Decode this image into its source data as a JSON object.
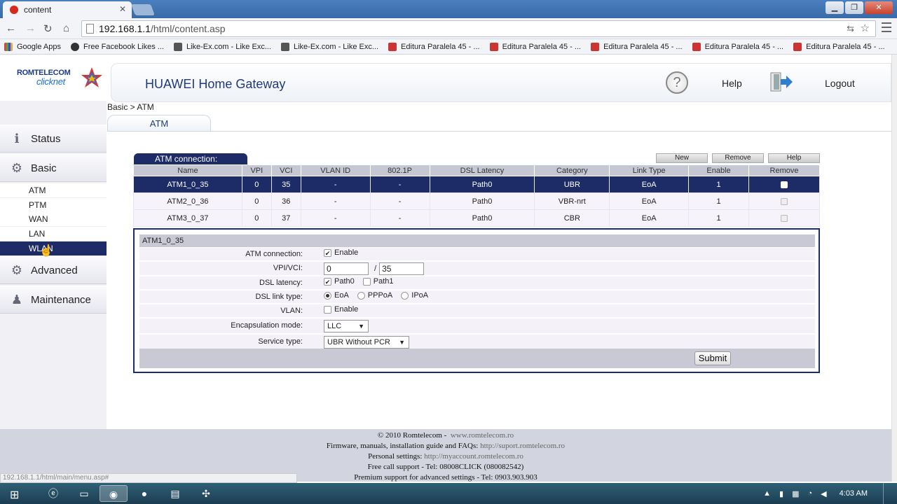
{
  "browser": {
    "tab_title": "content",
    "url_host": "192.168.1.1",
    "url_path": "/html/content.asp",
    "bookmarks": [
      "Google Apps",
      "Free Facebook Likes ...",
      "Like-Ex.com - Like Exc...",
      "Like-Ex.com - Like Exc...",
      "Editura Paralela 45 - ...",
      "Editura Paralela 45 - ...",
      "Editura Paralela 45 - ...",
      "Editura Paralela 45 - ...",
      "Editura Paralela 45 - ..."
    ],
    "status_url": "192.168.1.1/html/main/menu.asp#"
  },
  "logo": {
    "line1": "ROMTELECOM",
    "line2": "clicknet"
  },
  "header": {
    "title": "HUAWEI Home Gateway",
    "help": "Help",
    "logout": "Logout"
  },
  "sidebar": {
    "groups": [
      "Status",
      "Basic",
      "Advanced",
      "Maintenance"
    ],
    "subitems": [
      "ATM",
      "PTM",
      "WAN",
      "LAN",
      "WLAN"
    ]
  },
  "breadcrumb": "Basic > ATM",
  "tab_label": "ATM",
  "atm": {
    "caption": "ATM connection:",
    "buttons": [
      "New",
      "Remove",
      "Help"
    ],
    "columns": [
      "Name",
      "VPI",
      "VCI",
      "VLAN ID",
      "802.1P",
      "DSL Latency",
      "Category",
      "Link Type",
      "Enable",
      "Remove"
    ],
    "rows": [
      [
        "ATM1_0_35",
        "0",
        "35",
        "-",
        "-",
        "Path0",
        "UBR",
        "EoA",
        "1"
      ],
      [
        "ATM2_0_36",
        "0",
        "36",
        "-",
        "-",
        "Path0",
        "VBR-nrt",
        "EoA",
        "1"
      ],
      [
        "ATM3_0_37",
        "0",
        "37",
        "-",
        "-",
        "Path0",
        "CBR",
        "EoA",
        "1"
      ]
    ]
  },
  "detail": {
    "title": "ATM1_0_35",
    "labels": {
      "atm_connection": "ATM connection:",
      "vpi_vci": "VPI/VCI:",
      "dsl_latency": "DSL latency:",
      "dsl_link_type": "DSL link type:",
      "vlan": "VLAN:",
      "encapsulation": "Encapsulation mode:",
      "service_type": "Service type:"
    },
    "enable": "Enable",
    "vpi": "0",
    "slash": "/",
    "vci": "35",
    "path0": "Path0",
    "path1": "Path1",
    "link_types": [
      "EoA",
      "PPPoA",
      "IPoA"
    ],
    "vlan_enable": "Enable",
    "encapsulation": "LLC",
    "service_type": "UBR Without PCR",
    "submit": "Submit"
  },
  "footer": {
    "line1_text": "© 2010 Romtelecom -",
    "line1_link": "www.romtelecom.ro",
    "line2_text": "Firmware, manuals, installation guide and FAQs:",
    "line2_link": "http://suport.romtelecom.ro",
    "line3_text": "Personal settings:",
    "line3_link": "http://myaccount.romtelecom.ro",
    "line4": "Free call support - Tel: 08008CLICK (080082542)",
    "line5": "Premium support for advanced settings - Tel: 0903.903.903"
  },
  "taskbar": {
    "time": "4:03 AM"
  },
  "colors": {
    "accent": "#1d2b66",
    "header_title": "#1f3b7a"
  }
}
